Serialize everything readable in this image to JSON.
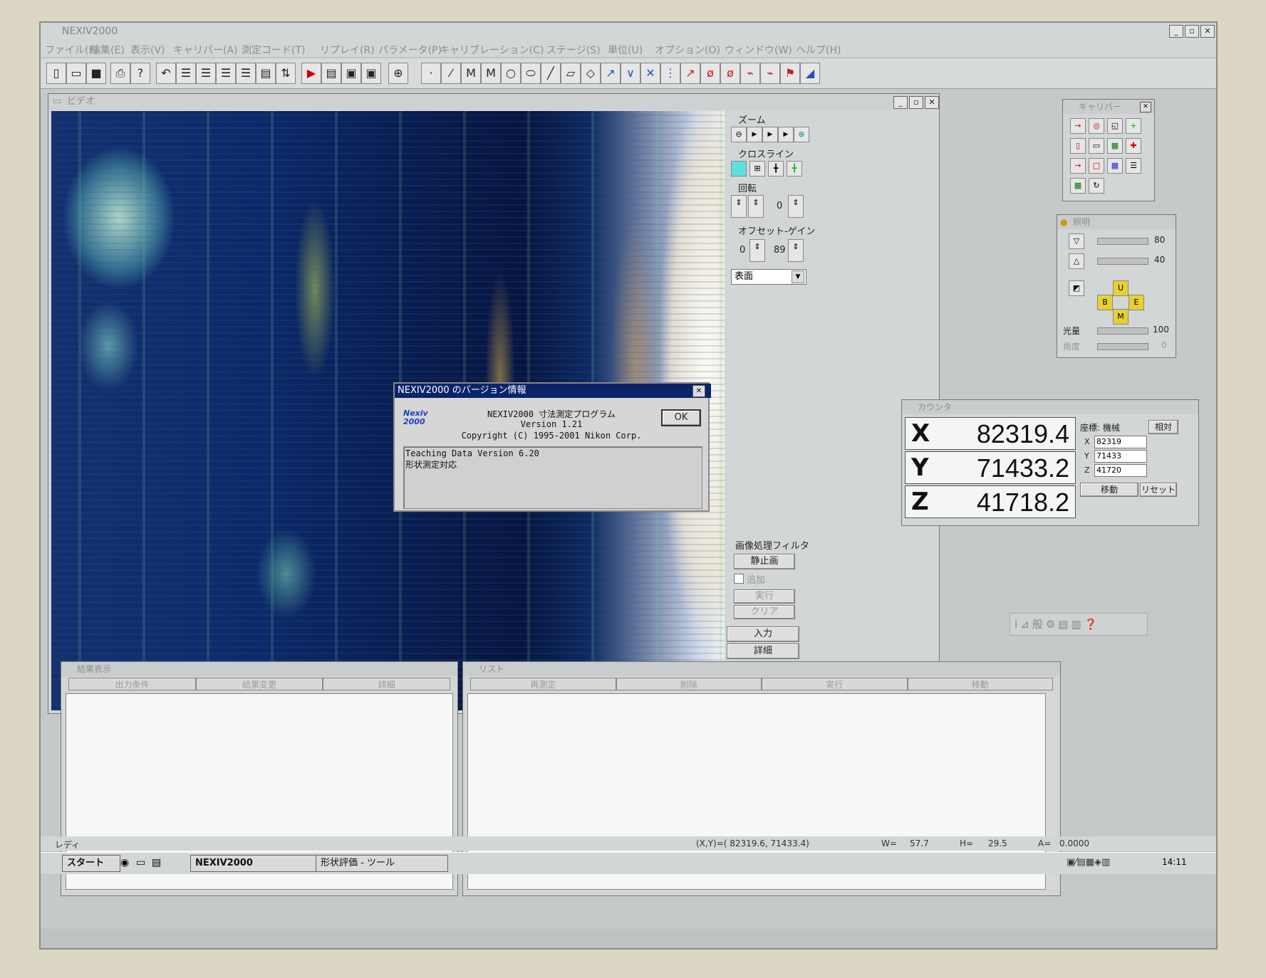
{
  "app_title": "NEXIV2000",
  "menu": [
    "ファイル(F)",
    "編集(E)",
    "表示(V)",
    "キャリパー(A)",
    "測定コード(T)",
    "リプレイ(R)",
    "パラメータ(P)",
    "キャリブレーション(C)",
    "ステージ(S)",
    "単位(U)",
    "オプション(O)",
    "ウィンドウ(W)",
    "ヘルプ(H)"
  ],
  "window_buttons": [
    "_",
    "▫",
    "✕"
  ],
  "video_window": {
    "title": "ビデオ"
  },
  "side": {
    "zoom_label": "ズーム",
    "crossline_label": "クロスライン",
    "rotate_label": "回転",
    "rotate_value": "0",
    "offset_gain_label": "オフセット-ゲイン",
    "offset_value": "0",
    "gain_value": "89",
    "surface_select": "表面",
    "image_filter_label": "画像処理フィルタ",
    "still_button": "静止画",
    "add_checkbox": "追加",
    "exec_button": "実行",
    "clear_button": "クリア",
    "input_button": "入力",
    "detail_button": "詳細"
  },
  "dialog": {
    "title": "NEXIV2000 のバージョン情報",
    "line1": "NEXIV2000 寸法測定プログラム",
    "line2": "Version 1.21",
    "line3": "Copyright (C) 1995-2001 Nikon Corp.",
    "ok": "OK",
    "box_line1": "Teaching Data Version 6.20",
    "box_line2": "形状測定対応",
    "logo_text": "Nexiv 2000"
  },
  "caliper": {
    "title": "キャリパー"
  },
  "lighting": {
    "title": "照明",
    "val1": "80",
    "val2": "40",
    "light_amount_label": "光量",
    "light_amount_value": "100",
    "angle_label": "角度",
    "angle_value": "0"
  },
  "counter": {
    "title": "カウンタ",
    "x_label": "X",
    "x_value": "82319.4",
    "y_label": "Y",
    "y_value": "71433.2",
    "z_label": "Z",
    "z_value": "41718.2",
    "coord_label": "座標: 機械",
    "relative_button": "相対",
    "in_x_label": "X",
    "in_x": "82319",
    "in_y_label": "Y",
    "in_y": "71433",
    "in_z_label": "Z",
    "in_z": "41720",
    "move_button": "移動",
    "reset_button": "リセット"
  },
  "results": {
    "title": "結果表示",
    "tabs": [
      "出力条件",
      "結果変更",
      "詳細"
    ]
  },
  "list": {
    "title": "リスト",
    "tabs": [
      "再測定",
      "削除",
      "実行",
      "移動"
    ]
  },
  "status": {
    "ready": "レディ",
    "xy": "(X,Y)=(   82319.6,   71433.4)",
    "w_label": "W=",
    "w": "57.7",
    "h_label": "H=",
    "h": "29.5",
    "a_label": "A=",
    "a": "0.0000"
  },
  "taskbar": {
    "start": "スタート",
    "task1": "NEXIV2000",
    "task2": "形状評価 - ツール",
    "clock": "14:11"
  },
  "colors": {
    "dialog_title_bg": "#0a246a",
    "video_bg": "#0c2a6a"
  }
}
